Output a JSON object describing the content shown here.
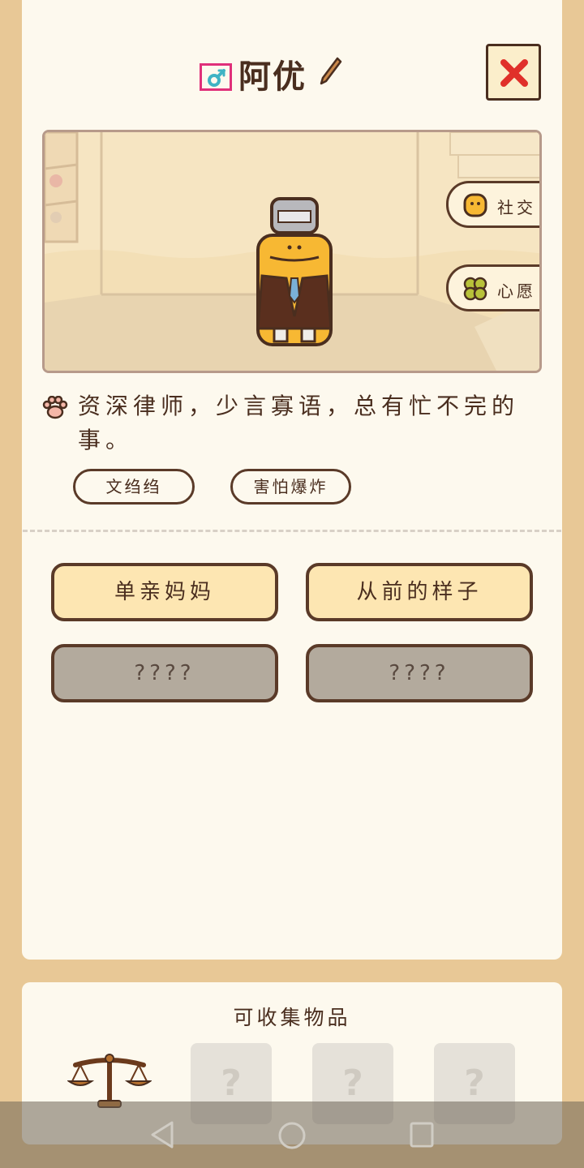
{
  "profile": {
    "name": "阿优",
    "gender": "male-icon",
    "description": "资深律师，少言寡语，总有忙不完的事。",
    "tags": [
      "文绉绉",
      "害怕爆炸"
    ]
  },
  "scene_buttons": {
    "social": "社交",
    "wish": "心愿"
  },
  "stories": [
    {
      "label": "单亲妈妈",
      "locked": false
    },
    {
      "label": "从前的样子",
      "locked": false
    },
    {
      "label": "????",
      "locked": true
    },
    {
      "label": "????",
      "locked": true
    }
  ],
  "collectibles": {
    "title": "可收集物品",
    "slots": [
      "?",
      "?",
      "?"
    ]
  },
  "colors": {
    "background": "#e8c896",
    "card": "#fdf9ee",
    "text": "#4a2e1f",
    "close": "#e0302a",
    "unlocked": "#fde6b2",
    "locked": "#b3aa9d"
  }
}
